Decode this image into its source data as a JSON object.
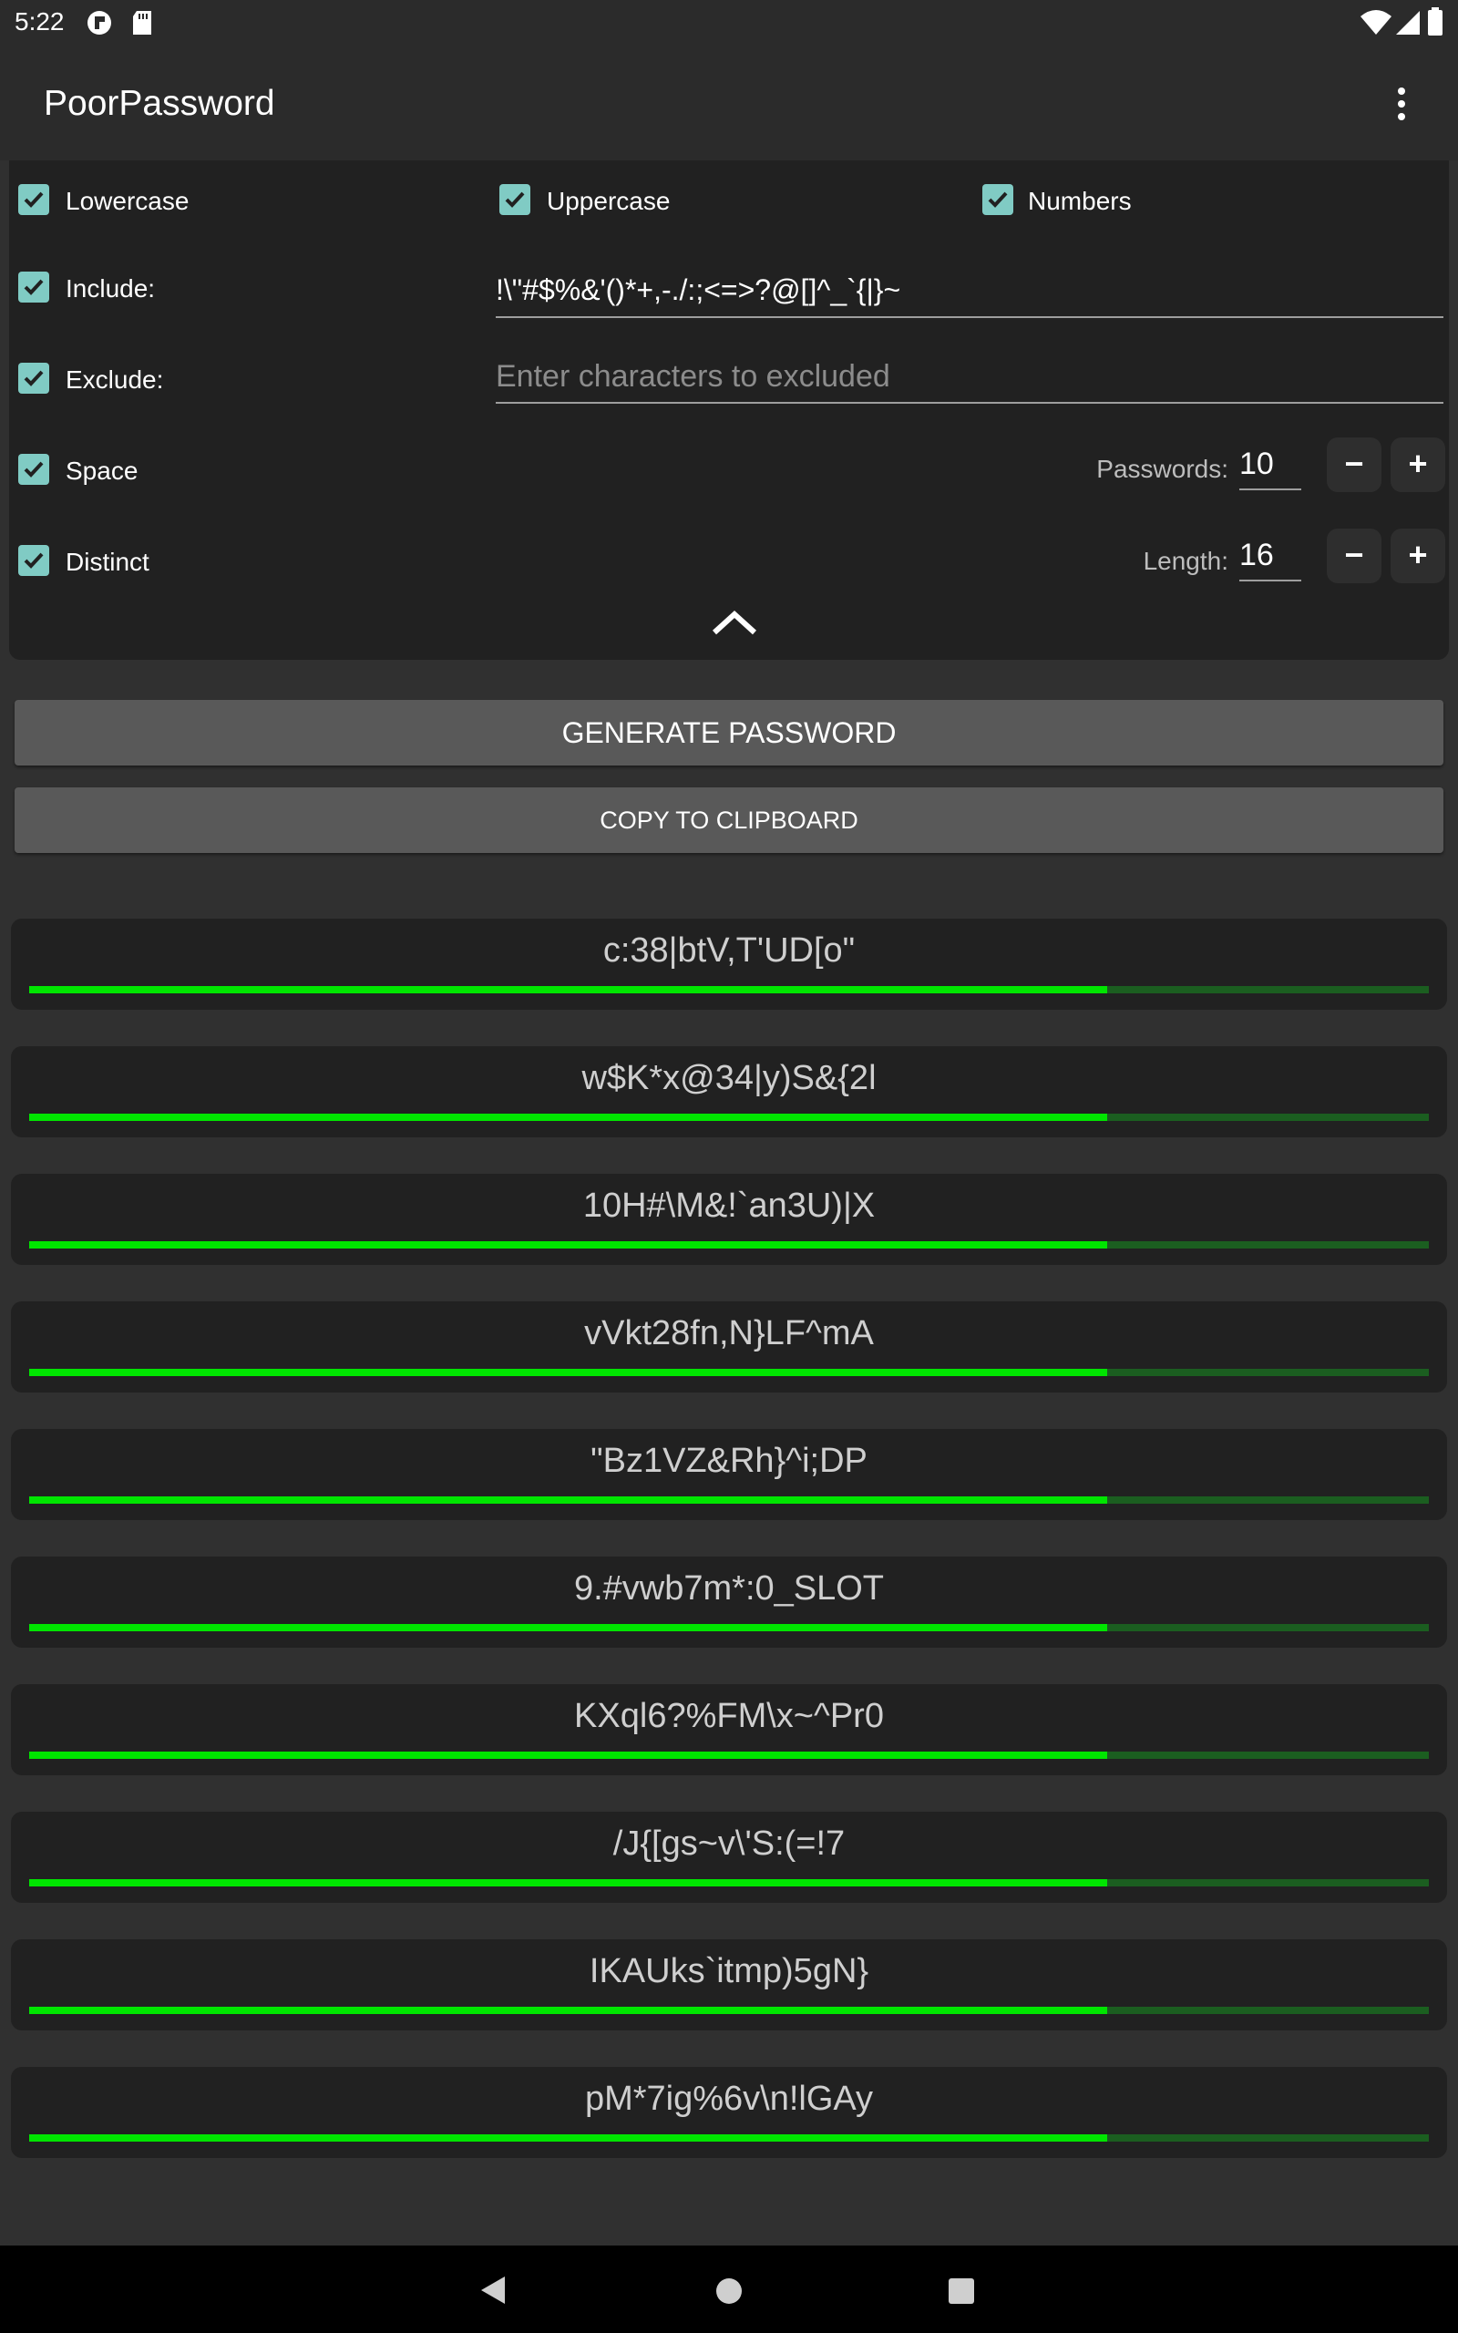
{
  "status_bar": {
    "time": "5:22",
    "left_icons": [
      "record-icon",
      "sd-card-icon"
    ],
    "right_icons": [
      "wifi-icon",
      "signal-icon",
      "battery-icon"
    ]
  },
  "app_bar": {
    "title": "PoorPassword",
    "menu_icon": "more-vert-icon"
  },
  "options": {
    "lowercase": {
      "label": "Lowercase",
      "checked": true
    },
    "uppercase": {
      "label": "Uppercase",
      "checked": true
    },
    "numbers": {
      "label": "Numbers",
      "checked": true
    },
    "include": {
      "label": "Include:",
      "checked": true,
      "value": "!\\\"#$%&'()*+,-./:;<=>?@[]^_`{|}~"
    },
    "exclude": {
      "label": "Exclude:",
      "checked": true,
      "value": "",
      "placeholder": "Enter characters to excluded"
    },
    "space": {
      "label": "Space",
      "checked": true
    },
    "distinct": {
      "label": "Distinct",
      "checked": true
    },
    "passwords": {
      "label": "Passwords:",
      "value": "10",
      "minus": "−",
      "plus": "+"
    },
    "length": {
      "label": "Length:",
      "value": "16",
      "minus": "−",
      "plus": "+"
    },
    "collapse_icon": "chevron-up-icon"
  },
  "actions": {
    "generate": "GENERATE PASSWORD",
    "copy": "COPY TO CLIPBOARD"
  },
  "passwords": [
    {
      "text": "c:38|btV,T'UD[o\"",
      "strength": 0.77
    },
    {
      "text": "w$K*x@34|y)S&{2l",
      "strength": 0.77
    },
    {
      "text": "10H#\\M&!`an3U)|X",
      "strength": 0.77
    },
    {
      "text": "vVkt28fn,N}LF^mA",
      "strength": 0.77
    },
    {
      "text": "\"Bz1VZ&Rh}^i;DP",
      "strength": 0.77
    },
    {
      "text": "9.#vwb7m*:0_SLOT",
      "strength": 0.77
    },
    {
      "text": "KXql6?%FM\\x~^Pr0",
      "strength": 0.77
    },
    {
      "text": "/J{[gs~v\\'S:(=!7",
      "strength": 0.77
    },
    {
      "text": "IKAUks`itmp)5gN}",
      "strength": 0.77
    },
    {
      "text": "pM*7ig%6v\\n!lGAy",
      "strength": 0.77
    }
  ],
  "colors": {
    "checkbox": "#80cbc4",
    "strength_fill": "#00e500",
    "strength_track": "#1b5e20",
    "background": "#303030",
    "panel": "#212121",
    "button": "#595959"
  },
  "nav_bar": {
    "icons": [
      "back-icon",
      "home-icon",
      "recents-icon"
    ]
  }
}
